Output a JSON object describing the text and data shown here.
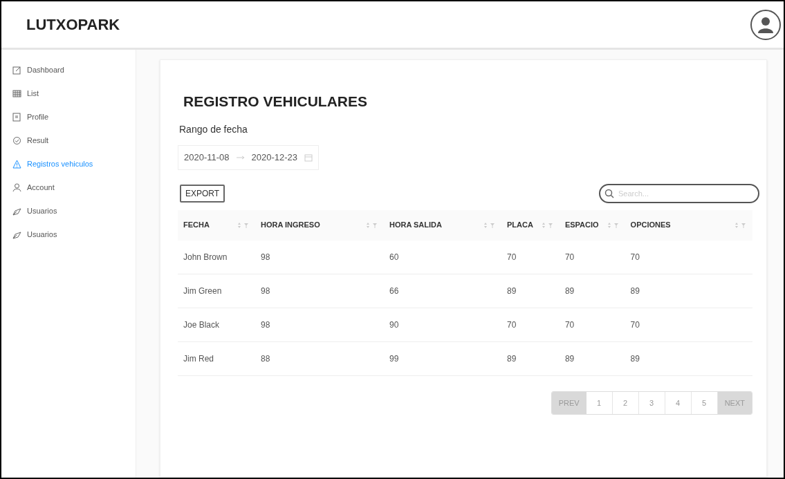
{
  "header": {
    "logo": "LUTXOPARK"
  },
  "sidebar": {
    "items": [
      {
        "label": "Dashboard",
        "selected": false
      },
      {
        "label": "List",
        "selected": false
      },
      {
        "label": "Profile",
        "selected": false
      },
      {
        "label": "Result",
        "selected": false
      },
      {
        "label": "Registros vehiculos",
        "selected": true
      },
      {
        "label": "Account",
        "selected": false
      },
      {
        "label": "Usuarios",
        "selected": false
      },
      {
        "label": "Usuarios",
        "selected": false
      }
    ]
  },
  "page": {
    "title": "REGISTRO VEHICULARES",
    "date_range": {
      "label": "Rango de fecha",
      "start": "2020-11-08",
      "end": "2020-12-23"
    },
    "export_button": "EXPORT",
    "search": {
      "placeholder": "Search..."
    }
  },
  "table": {
    "columns": [
      "FECHA",
      "HORA INGRESO",
      "HORA SALIDA",
      "PLACA",
      "ESPACIO",
      "OPCIONES"
    ],
    "rows": [
      [
        "John Brown",
        "98",
        "60",
        "70",
        "70",
        "70"
      ],
      [
        "Jim Green",
        "98",
        "66",
        "89",
        "89",
        "89"
      ],
      [
        "Joe Black",
        "98",
        "90",
        "70",
        "70",
        "70"
      ],
      [
        "Jim Red",
        "88",
        "99",
        "89",
        "89",
        "89"
      ]
    ]
  },
  "pagination": {
    "prev": {
      "label": "PREV",
      "disabled": true
    },
    "pages": [
      "1",
      "2",
      "3",
      "4",
      "5"
    ],
    "next": {
      "label": "NEXT",
      "disabled": true
    }
  }
}
